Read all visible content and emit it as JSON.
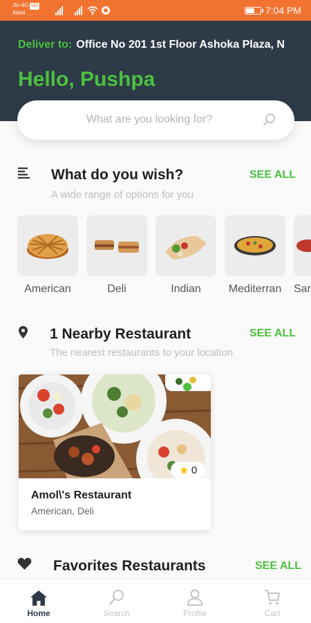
{
  "status_bar": {
    "carrier_line1": "Jio 4G",
    "carrier_badge": "HD",
    "carrier_line2": "Airtel",
    "time": "7:04 PM"
  },
  "header": {
    "deliver_label": "Deliver to:",
    "address": "Office No 201 1st Floor Ashoka Plaza, N",
    "greeting": "Hello, Pushpa"
  },
  "search": {
    "placeholder": "What are you looking for?"
  },
  "wish_section": {
    "title": "What do you wish?",
    "subtitle": "A wide range of options for you",
    "see_all": "SEE ALL",
    "categories": [
      {
        "label": "American"
      },
      {
        "label": "Deli"
      },
      {
        "label": "Indian"
      },
      {
        "label": "Mediterran"
      },
      {
        "label": "Sar"
      }
    ]
  },
  "nearby_section": {
    "title": "1 Nearby Restaurant",
    "subtitle": "The nearest restaurants to your location",
    "see_all": "SEE ALL",
    "restaurant": {
      "name": "Amol\\'s Restaurant",
      "cuisines": "American, Deli",
      "rating": "0"
    }
  },
  "favorites_section": {
    "title": "Favorites Restaurants",
    "see_all": "SEE ALL"
  },
  "bottom_nav": [
    {
      "label": "Home",
      "icon": "home-icon",
      "active": true
    },
    {
      "label": "Search",
      "icon": "search-icon",
      "active": false
    },
    {
      "label": "Profile",
      "icon": "profile-icon",
      "active": false
    },
    {
      "label": "Cart",
      "icon": "cart-icon",
      "active": false
    }
  ],
  "colors": {
    "accent_green": "#4cc13f",
    "header_bg": "#2d3a47",
    "status_bar_bg": "#f27330"
  }
}
